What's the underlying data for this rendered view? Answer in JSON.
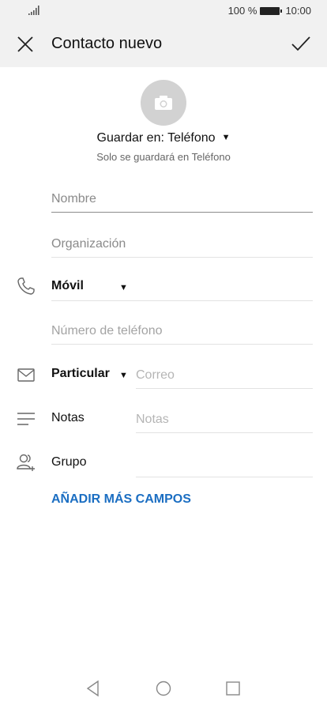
{
  "status_bar": {
    "battery": "100 %",
    "time": "10:00"
  },
  "app_bar": {
    "title": "Contacto nuevo"
  },
  "storage": {
    "label": "Guardar en: Teléfono",
    "note": "Solo se guardará en Teléfono"
  },
  "fields": {
    "name_placeholder": "Nombre",
    "organization_placeholder": "Organización",
    "phone_type": "Móvil",
    "phone_placeholder": "Número de teléfono",
    "email_type": "Particular",
    "email_placeholder": "Correo",
    "notes_label": "Notas",
    "notes_placeholder": "Notas",
    "group_label": "Grupo"
  },
  "add_more": "AÑADIR MÁS CAMPOS",
  "icons": [
    "signal-icon",
    "battery-icon",
    "close-icon",
    "check-icon",
    "camera-icon",
    "phone-icon",
    "mail-icon",
    "notes-icon",
    "group-icon",
    "nav-back-icon",
    "nav-home-icon",
    "nav-recents-icon"
  ],
  "colors": {
    "accent": "#1b6ec2",
    "bar_bg": "#f1f1f1",
    "photo_bg": "#d2d2d2"
  }
}
